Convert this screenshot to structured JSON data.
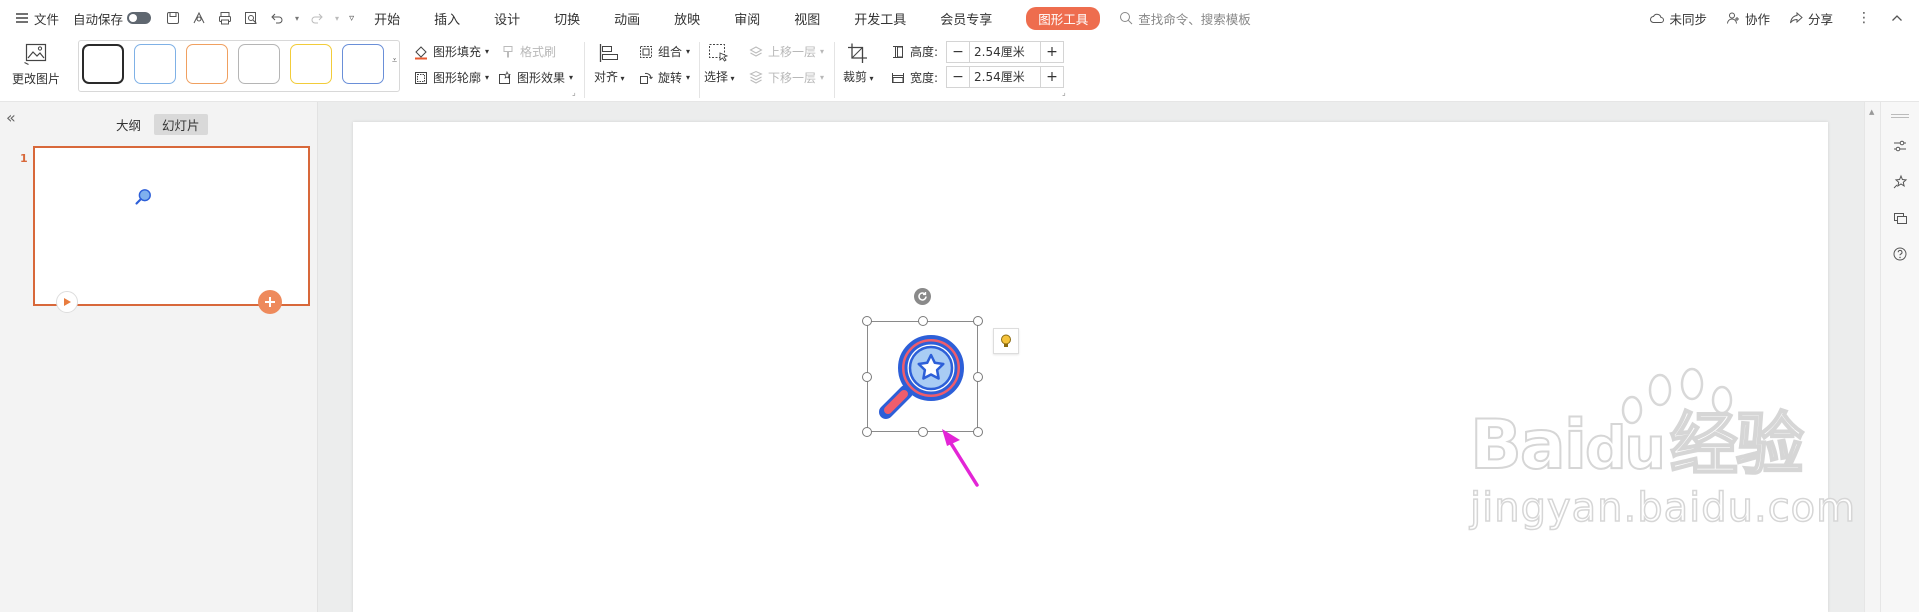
{
  "topbar": {
    "menu_label": "文件",
    "autosave_label": "自动保存",
    "tabs": [
      "开始",
      "插入",
      "设计",
      "切换",
      "动画",
      "放映",
      "审阅",
      "视图",
      "开发工具",
      "会员专享"
    ],
    "active_tab": "图形工具",
    "search_placeholder": "查找命令、搜索模板",
    "sync_label": "未同步",
    "collab_label": "协作",
    "share_label": "分享"
  },
  "ribbon": {
    "change_picture": "更改图片",
    "fill": "图形填充",
    "format_brush": "格式刷",
    "outline": "图形轮廓",
    "effect": "图形效果",
    "align": "对齐",
    "group": "组合",
    "rotate": "旋转",
    "select": "选择",
    "bring_forward": "上移一层",
    "send_backward": "下移一层",
    "crop": "裁剪",
    "height_label": "高度:",
    "height_value": "2.54厘米",
    "width_label": "宽度:",
    "width_value": "2.54厘米",
    "minus": "−",
    "plus": "+",
    "style_colors": [
      "#2a2a2a",
      "#7fb1e6",
      "#f0a060",
      "#b5b5b5",
      "#f2cc3a",
      "#6a8fd8"
    ]
  },
  "left_panel": {
    "outline_tab": "大纲",
    "slides_tab": "幻灯片",
    "slide_number": "1"
  },
  "watermark": {
    "brand": "Bai",
    "brand_paw": "du",
    "brand_cn": "经验",
    "url": "jingyan.baidu.com"
  },
  "colors": {
    "accent": "#ee6d4e",
    "selection_arrow": "#e325d6",
    "icon_blue": "#2d5fd8",
    "icon_red": "#ee5d6c"
  }
}
